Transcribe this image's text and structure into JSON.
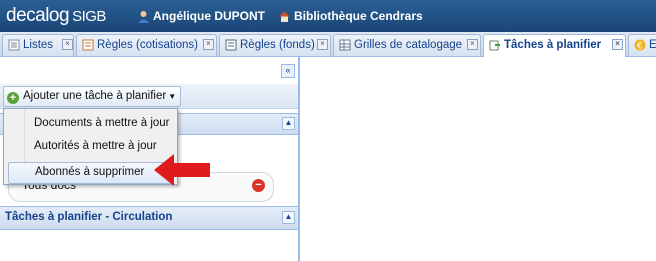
{
  "app": {
    "brand": "decalog",
    "brand_suffix": "SIGB",
    "user": "Angélique DUPONT",
    "library": "Bibliothèque Cendrars"
  },
  "tabs": [
    {
      "label": "Listes",
      "icon": "list-icon"
    },
    {
      "label": "Règles (cotisations)",
      "icon": "rules-icon"
    },
    {
      "label": "Règles (fonds)",
      "icon": "rules-icon"
    },
    {
      "label": "Grilles de catalogage",
      "icon": "grid-icon"
    },
    {
      "label": "Tâches à planifier",
      "icon": "task-icon",
      "active": true
    },
    {
      "label": "E",
      "icon": "euro-icon"
    }
  ],
  "toolbar": {
    "add_task_label": "Ajouter une tâche à planifier"
  },
  "menu": {
    "items": [
      "Documents à mettre à jour",
      "Autorités à mettre à jour",
      "Abonnés à supprimer"
    ],
    "highlighted": 2
  },
  "panel": {
    "row_label": "Tous docs",
    "section2_title": "Tâches à planifier - Circulation"
  },
  "colors": {
    "topbar": "#1b4676",
    "accent": "#15428b",
    "arrow": "#e01b1b"
  }
}
